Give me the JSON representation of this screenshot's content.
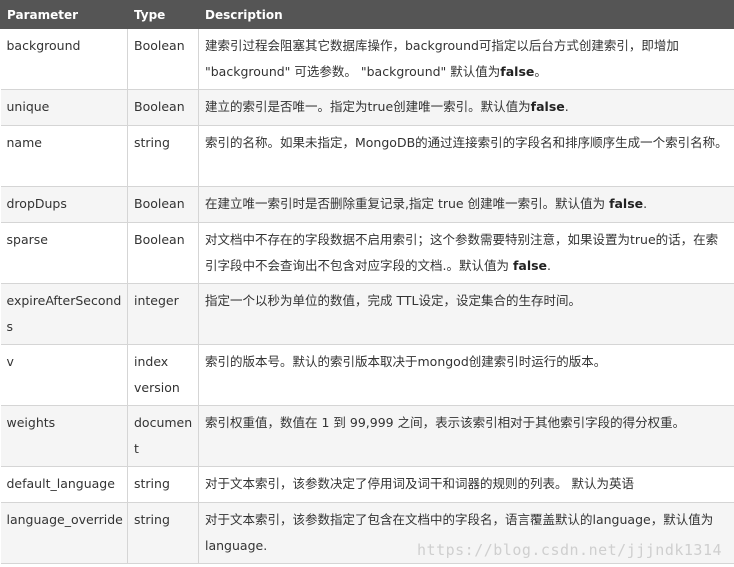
{
  "table": {
    "headers": [
      "Parameter",
      "Type",
      "Description"
    ],
    "rows": [
      {
        "param": "background",
        "type": "Boolean",
        "desc": "建索引过程会阻塞其它数据库操作，background可指定以后台方式创建索引，即增加 \"background\" 可选参数。 \"background\" 默认值为",
        "bold": "false",
        "tail": "。"
      },
      {
        "param": "unique",
        "type": "Boolean",
        "desc": "建立的索引是否唯一。指定为true创建唯一索引。默认值为",
        "bold": "false",
        "tail": "."
      },
      {
        "param": "name",
        "type": "string",
        "desc": "索引的名称。如果未指定，MongoDB的通过连接索引的字段名和排序顺序生成一个索引名称。",
        "bold": "",
        "tail": ""
      },
      {
        "param": "dropDups",
        "type": "Boolean",
        "desc": "在建立唯一索引时是否删除重复记录,指定 true 创建唯一索引。默认值为 ",
        "bold": "false",
        "tail": "."
      },
      {
        "param": "sparse",
        "type": "Boolean",
        "desc": "对文档中不存在的字段数据不启用索引；这个参数需要特别注意，如果设置为true的话，在索引字段中不会查询出不包含对应字段的文档.。默认值为 ",
        "bold": "false",
        "tail": "."
      },
      {
        "param": "expireAfterSeconds",
        "type": "integer",
        "desc": "指定一个以秒为单位的数值，完成 TTL设定，设定集合的生存时间。",
        "bold": "",
        "tail": ""
      },
      {
        "param": "v",
        "type": "index version",
        "desc": "索引的版本号。默认的索引版本取决于mongod创建索引时运行的版本。",
        "bold": "",
        "tail": ""
      },
      {
        "param": "weights",
        "type": "document",
        "desc": "索引权重值，数值在 1 到 99,999 之间，表示该索引相对于其他索引字段的得分权重。",
        "bold": "",
        "tail": ""
      },
      {
        "param": "default_language",
        "type": "string",
        "desc": "对于文本索引，该参数决定了停用词及词干和词器的规则的列表。 默认为英语",
        "bold": "",
        "tail": ""
      },
      {
        "param": "language_override",
        "type": "string",
        "desc": "对于文本索引，该参数指定了包含在文档中的字段名，语言覆盖默认的language，默认值为 language.",
        "bold": "",
        "tail": ""
      }
    ]
  },
  "watermark": "https://blog.csdn.net/jjjndk1314"
}
